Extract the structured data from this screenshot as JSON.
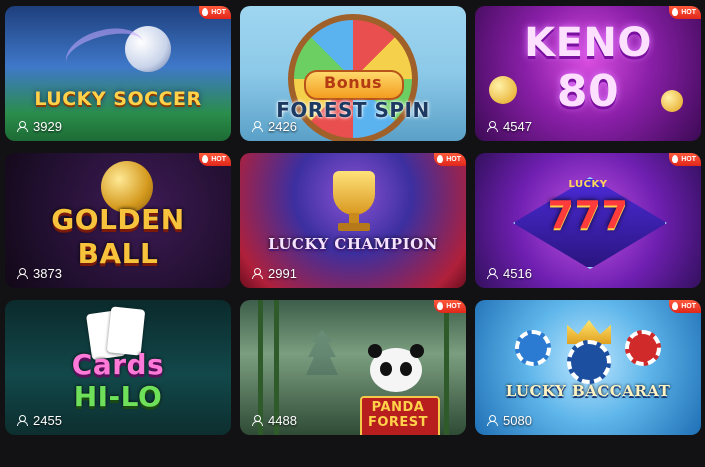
{
  "games": [
    {
      "title": "LUCKY SOCCER",
      "players": "3929",
      "hot": true,
      "hot_label": "HOT",
      "icon": "user-icon"
    },
    {
      "title_line1": "Bonus",
      "title_line2": "FOREST SPIN",
      "players": "2426",
      "hot": false,
      "icon": "user-icon"
    },
    {
      "title_line1": "KENO",
      "title_line2": "80",
      "players": "4547",
      "hot": true,
      "hot_label": "HOT",
      "icon": "user-icon"
    },
    {
      "title_line1": "GOLDEN",
      "title_line2": "BALL",
      "players": "3873",
      "hot": true,
      "hot_label": "HOT",
      "icon": "user-icon"
    },
    {
      "title": "LUCKY CHAMPION",
      "players": "2991",
      "hot": true,
      "hot_label": "HOT",
      "icon": "user-icon"
    },
    {
      "title_top": "LUCKY",
      "title": "777",
      "players": "4516",
      "hot": true,
      "hot_label": "HOT",
      "icon": "user-icon"
    },
    {
      "title_line1": "Cards",
      "title_line2": "HI-LO",
      "players": "2455",
      "hot": false,
      "icon": "user-icon"
    },
    {
      "title_line1": "PANDA",
      "title_line2": "FOREST",
      "players": "4488",
      "hot": true,
      "hot_label": "HOT",
      "icon": "user-icon"
    },
    {
      "title": "LUCKY BACCARAT",
      "players": "5080",
      "hot": true,
      "hot_label": "HOT",
      "icon": "user-icon"
    }
  ],
  "colors": {
    "background": "#121214",
    "hot_badge": "#e0261a",
    "text": "#ffffff"
  }
}
